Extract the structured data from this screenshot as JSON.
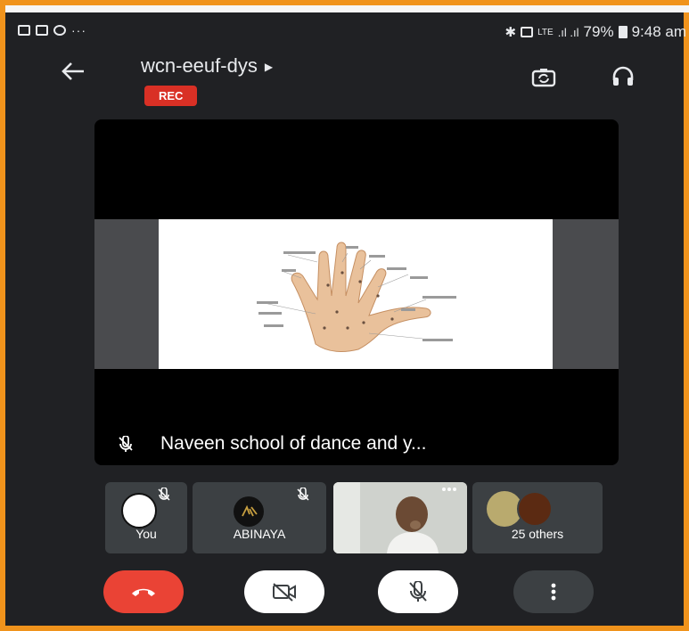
{
  "status_bar": {
    "battery": "79%",
    "time": "9:48 am",
    "overflow_dots": "···",
    "network": "LTE"
  },
  "meeting": {
    "code": "wcn-eeuf-dys",
    "rec_badge": "REC"
  },
  "main_tile": {
    "presenter_name": "Naveen school of dance and y..."
  },
  "participants": [
    {
      "label": "You"
    },
    {
      "label": "ABINAYA"
    },
    {
      "label": "25 others"
    }
  ],
  "colors": {
    "frame_border": "#f0931c",
    "background": "#202124",
    "end_call": "#ea4335",
    "rec": "#d93025"
  },
  "icons": {
    "back": "arrow-left-icon",
    "camera_switch": "camera-switch-icon",
    "audio_output": "headphones-icon",
    "end_call": "phone-hangup-icon",
    "camera_off": "camera-off-icon",
    "mic_off": "mic-off-icon",
    "more": "more-vert-icon"
  }
}
